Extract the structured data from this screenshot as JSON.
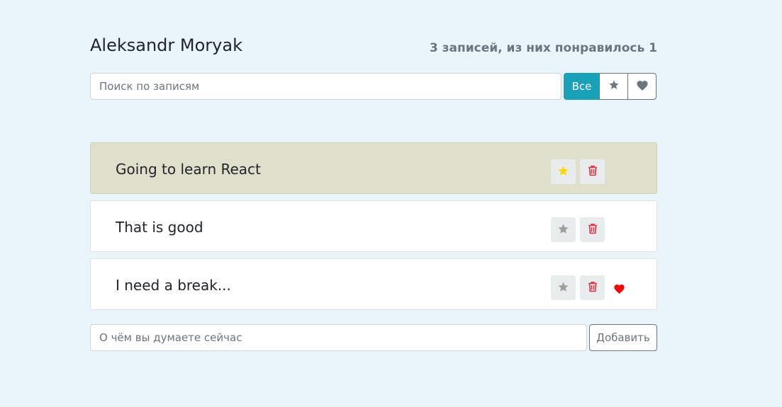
{
  "header": {
    "title": "Aleksandr Moryak",
    "stats": "3 записей, из них понравилось 1"
  },
  "search": {
    "placeholder": "Поиск по записям",
    "value": ""
  },
  "filters": {
    "all_label": "Все",
    "active": "all",
    "favorites_icon": "star-icon",
    "liked_icon": "heart-icon"
  },
  "posts": [
    {
      "label": "Going to learn React",
      "important": true,
      "liked": false
    },
    {
      "label": "That is good",
      "important": false,
      "liked": false
    },
    {
      "label": "I need a break...",
      "important": false,
      "liked": true
    }
  ],
  "add_form": {
    "placeholder": "О чём вы думаете сейчас",
    "value": "",
    "button_label": "Добавить"
  },
  "colors": {
    "background": "#e9f4fb",
    "accent": "#17a2b8",
    "important_row": "#dfdfcc",
    "star_active": "#ffd700",
    "star_inactive": "#9e9e9e",
    "trash": "#dc3545",
    "heart": "#ff0000"
  }
}
